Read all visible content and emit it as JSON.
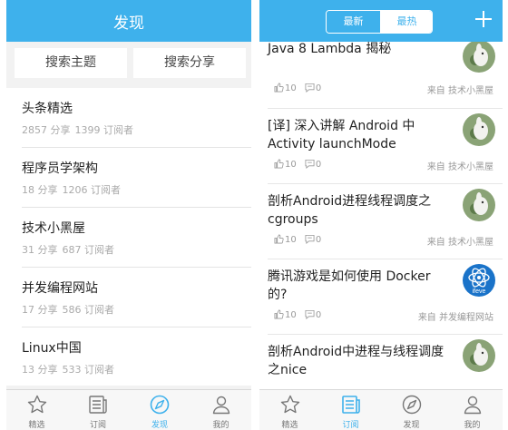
{
  "left": {
    "header_title": "发现",
    "search_topic": "搜索主题",
    "search_share": "搜索分享",
    "topics": [
      {
        "title": "头条精选",
        "shares": "2857 分享",
        "subscribers": "1399 订阅者"
      },
      {
        "title": "程序员学架构",
        "shares": "18 分享",
        "subscribers": "1206 订阅者"
      },
      {
        "title": "技术小黑屋",
        "shares": "31 分享",
        "subscribers": "687 订阅者"
      },
      {
        "title": "并发编程网站",
        "shares": "17 分享",
        "subscribers": "586 订阅者"
      },
      {
        "title": "Linux中国",
        "shares": "13 分享",
        "subscribers": "533 订阅者"
      }
    ],
    "tabs": [
      {
        "label": "精选",
        "icon": "star-icon"
      },
      {
        "label": "订阅",
        "icon": "news-icon"
      },
      {
        "label": "发现",
        "icon": "compass-icon",
        "active": true
      },
      {
        "label": "我的",
        "icon": "person-icon"
      }
    ]
  },
  "right": {
    "segment": {
      "newest": "最新",
      "hottest": "最热"
    },
    "add_icon": "plus-icon",
    "feed": [
      {
        "title_lines": [
          "Java 8 Lambda 揭秘"
        ],
        "likes": "10",
        "comments": "0",
        "source": "来自 技术小黑屋",
        "avatar": "bird-avatar"
      },
      {
        "title_lines": [
          "[译] 深入讲解 Android 中",
          "Activity launchMode"
        ],
        "likes": "10",
        "comments": "0",
        "source": "来自 技术小黑屋",
        "avatar": "bird-avatar"
      },
      {
        "title_lines": [
          "剖析Android进程线程调度之",
          "cgroups"
        ],
        "likes": "10",
        "comments": "0",
        "source": "来自 技术小黑屋",
        "avatar": "bird-avatar"
      },
      {
        "title_lines": [
          "腾讯游戏是如何使用 Docker",
          "的?"
        ],
        "likes": "10",
        "comments": "0",
        "source": "来自 并发编程网站",
        "avatar": "ifeve-logo",
        "avatar_text": "ifeve"
      },
      {
        "title_lines": [
          "剖析Android中进程与线程调度",
          "之nice"
        ],
        "avatar": "bird-avatar"
      }
    ],
    "tabs": [
      {
        "label": "精选",
        "icon": "star-icon"
      },
      {
        "label": "订阅",
        "icon": "news-icon",
        "active": true
      },
      {
        "label": "发现",
        "icon": "compass-icon"
      },
      {
        "label": "我的",
        "icon": "person-icon"
      }
    ]
  },
  "colors": {
    "accent": "#3eb1ec",
    "tab_inactive": "#777777"
  }
}
